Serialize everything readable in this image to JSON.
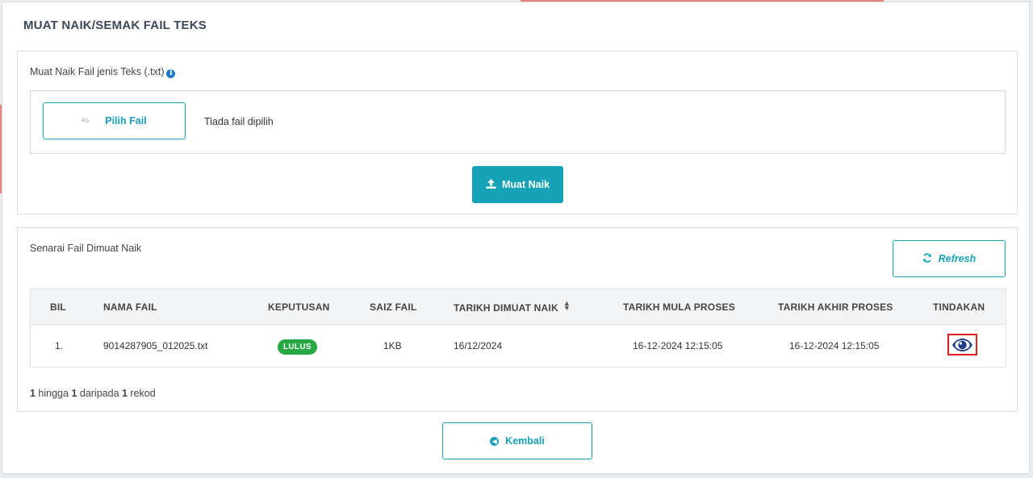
{
  "page_title": "MUAT NAIK/SEMAK FAIL TEKS",
  "upload": {
    "label": "Muat Naik Fail jenis Teks (.txt)",
    "choose_button": "Pilih Fail",
    "file_status": "Tiada fail dipilih",
    "upload_button": "Muat Naik"
  },
  "list": {
    "label": "Senarai Fail Dimuat Naik",
    "refresh_button": "Refresh",
    "columns": [
      "BIL",
      "NAMA FAIL",
      "KEPUTUSAN",
      "SAIZ FAIL",
      "TARIKH DIMUAT NAIK",
      "TARIKH MULA PROSES",
      "TARIKH AKHIR PROSES",
      "TINDAKAN"
    ],
    "rows": [
      {
        "bil": "1.",
        "nama_fail": "9014287905_012025.txt",
        "keputusan": "LULUS",
        "saiz_fail": "1KB",
        "tarikh_dimuat_naik": "16/12/2024",
        "tarikh_mula_proses": "16-12-2024 12:15:05",
        "tarikh_akhir_proses": "16-12-2024 12:15:05"
      }
    ],
    "record_info": {
      "from": "1",
      "text_to": " hingga ",
      "to": "1",
      "text_of": " daripada ",
      "total": "1",
      "text_rec": " rekod"
    }
  },
  "back_button": "Kembali",
  "colors": {
    "accent": "#17a2b8",
    "success": "#28a745",
    "highlight": "#e02020",
    "eye_icon": "#1f3c88"
  },
  "icons": {
    "info": "info-icon",
    "attach": "paperclip-icon",
    "upload": "upload-icon",
    "refresh": "refresh-icon",
    "sort": "sort-icon",
    "view": "eye-icon",
    "back": "arrow-left-circle-icon"
  }
}
